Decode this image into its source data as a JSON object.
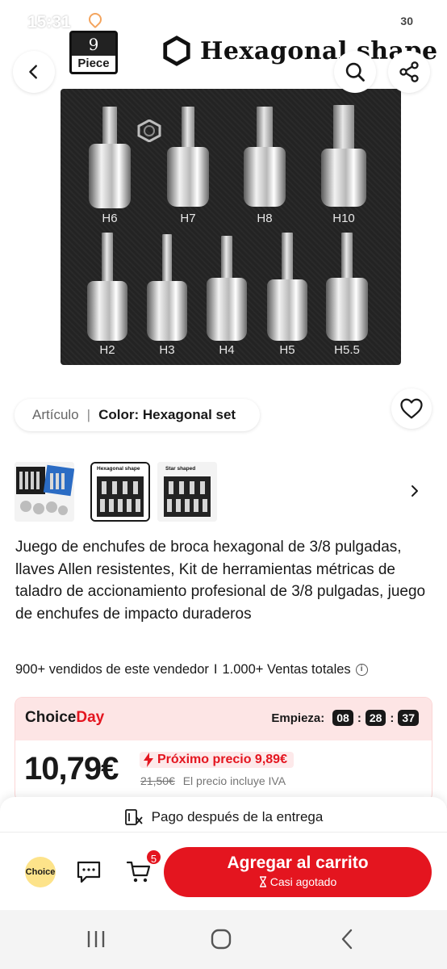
{
  "status_bar": {
    "time": "15:31",
    "battery": "30"
  },
  "header": {
    "back_icon": "chevron-left-icon",
    "search_icon": "search-icon",
    "share_icon": "share-icon"
  },
  "product_image": {
    "piece_badge_number": "9",
    "piece_badge_word": "Piece",
    "banner_title": "Hexagonal shape",
    "socket_labels_top": [
      "H6",
      "H7",
      "H8",
      "H10"
    ],
    "socket_labels_bottom": [
      "H2",
      "H3",
      "H4",
      "H5",
      "H5.5"
    ]
  },
  "variant": {
    "article_label": "Artículo",
    "separator": "|",
    "color_text": "Color: Hexagonal set"
  },
  "thumbnails": {
    "items": [
      {
        "name": "thumbnail-1"
      },
      {
        "name": "thumbnail-2",
        "selected": true,
        "caption": "Hexagonal shape"
      },
      {
        "name": "thumbnail-3",
        "caption": "Star shaped"
      }
    ]
  },
  "product": {
    "title": "Juego de enchufes de broca hexagonal de 3/8 pulgadas, llaves Allen resistentes, Kit de herramientas métricas de taladro de accionamiento profesional de 3/8 pulgadas, juego de enchufes de impacto duraderos",
    "sales_vendor": "900+ vendidos de este vendedor",
    "sales_sep": "I",
    "sales_total": "1.000+ Ventas totales"
  },
  "choice_day": {
    "logo_part1": "Choice",
    "logo_part2": "Day",
    "starts_label": "Empieza:",
    "hours": "08",
    "minutes": "28",
    "seconds": "37",
    "price": "10,79€",
    "next_price": "Próximo precio 9,89€",
    "old_price": "21,50€",
    "vat_note": "El precio incluye IVA"
  },
  "bottom_bar": {
    "pay_later": "Pago después de la entrega",
    "choice_badge": "Choice",
    "cart_count": "5",
    "add_to_cart": "Agregar al carrito",
    "stock_note": "Casi agotado"
  },
  "colors": {
    "accent_red": "#e4151f",
    "choice_bg": "#fde5e5",
    "choice_yellow": "#fde38a"
  }
}
